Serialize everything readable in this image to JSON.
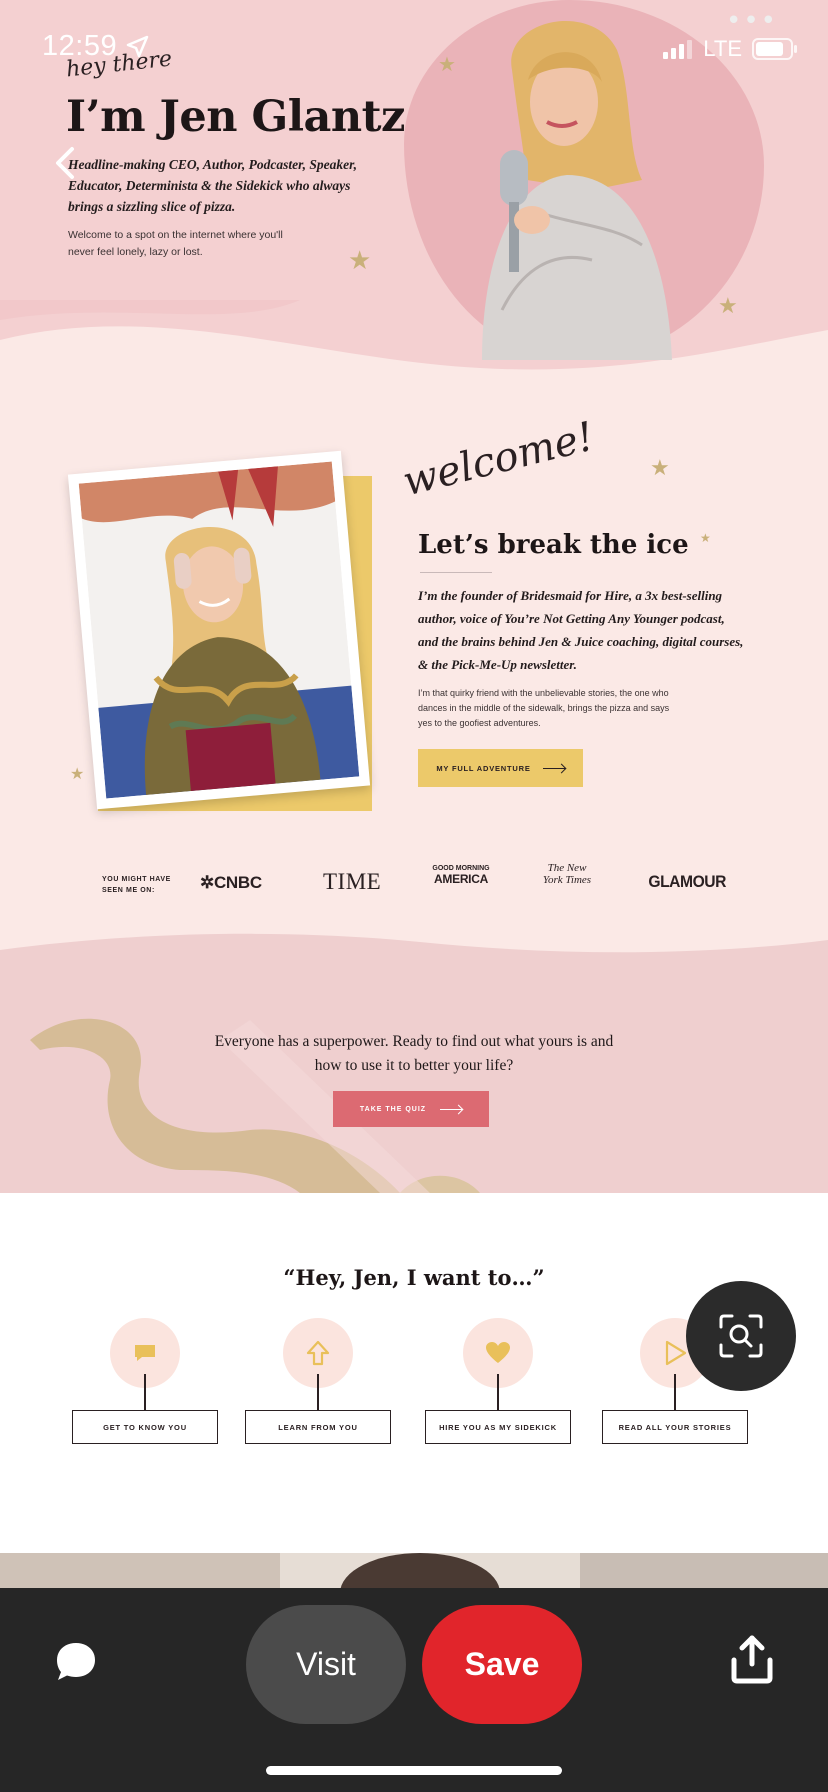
{
  "status_bar": {
    "time": "12:59",
    "network": "LTE"
  },
  "hero": {
    "script": "hey there",
    "title": "I’m Jen Glantz",
    "description": "Headline-making CEO, Author, Podcaster, Speaker, Educator, Determinista & the Sidekick who always brings a sizzling slice of pizza.",
    "subtext": "Welcome to a spot on the internet where you'll never feel lonely, lazy or lost."
  },
  "welcome": {
    "script": "welcome!",
    "title": "Let’s break the ice",
    "bold_text": "I’m the founder of Bridesmaid for Hire, a 3x best-selling author, voice of You’re Not Getting Any Younger podcast, and the brains behind Jen & Juice coaching, digital courses, & the Pick-Me-Up newsletter.",
    "small_text": "I’m that quirky friend with the unbelievable stories, the one who dances in the middle of the sidewalk, brings the pizza and says yes to the goofiest adventures.",
    "button_label": "MY FULL ADVENTURE"
  },
  "press": {
    "label": "YOU MIGHT HAVE SEEN ME ON:",
    "logos": {
      "cnbc": "CNBC",
      "time": "TIME",
      "gma_top": "GOOD MORNING",
      "gma_bottom": "AMERICA",
      "nyt": "The New York Times",
      "glamour": "GLAMOUR"
    }
  },
  "quiz": {
    "text": "Everyone has a superpower. Ready to find out what yours is and how to use it to better your life?",
    "button_label": "TAKE THE QUIZ"
  },
  "wants": {
    "title": "“Hey, Jen, I want to…”",
    "items": [
      {
        "label": "GET TO KNOW YOU",
        "icon": "chat-bubble-icon"
      },
      {
        "label": "LEARN FROM YOU",
        "icon": "arrow-up-icon"
      },
      {
        "label": "HIRE YOU AS MY SIDEKICK",
        "icon": "heart-icon"
      },
      {
        "label": "READ ALL YOUR STORIES",
        "icon": "play-icon"
      }
    ]
  },
  "bottom_bar": {
    "visit": "Visit",
    "save": "Save"
  },
  "colors": {
    "hero_pink": "#f4d0d1",
    "cream": "#fbe9e6",
    "yellow": "#ecc96a",
    "coral": "#dc6a72",
    "save_red": "#e1252b"
  }
}
